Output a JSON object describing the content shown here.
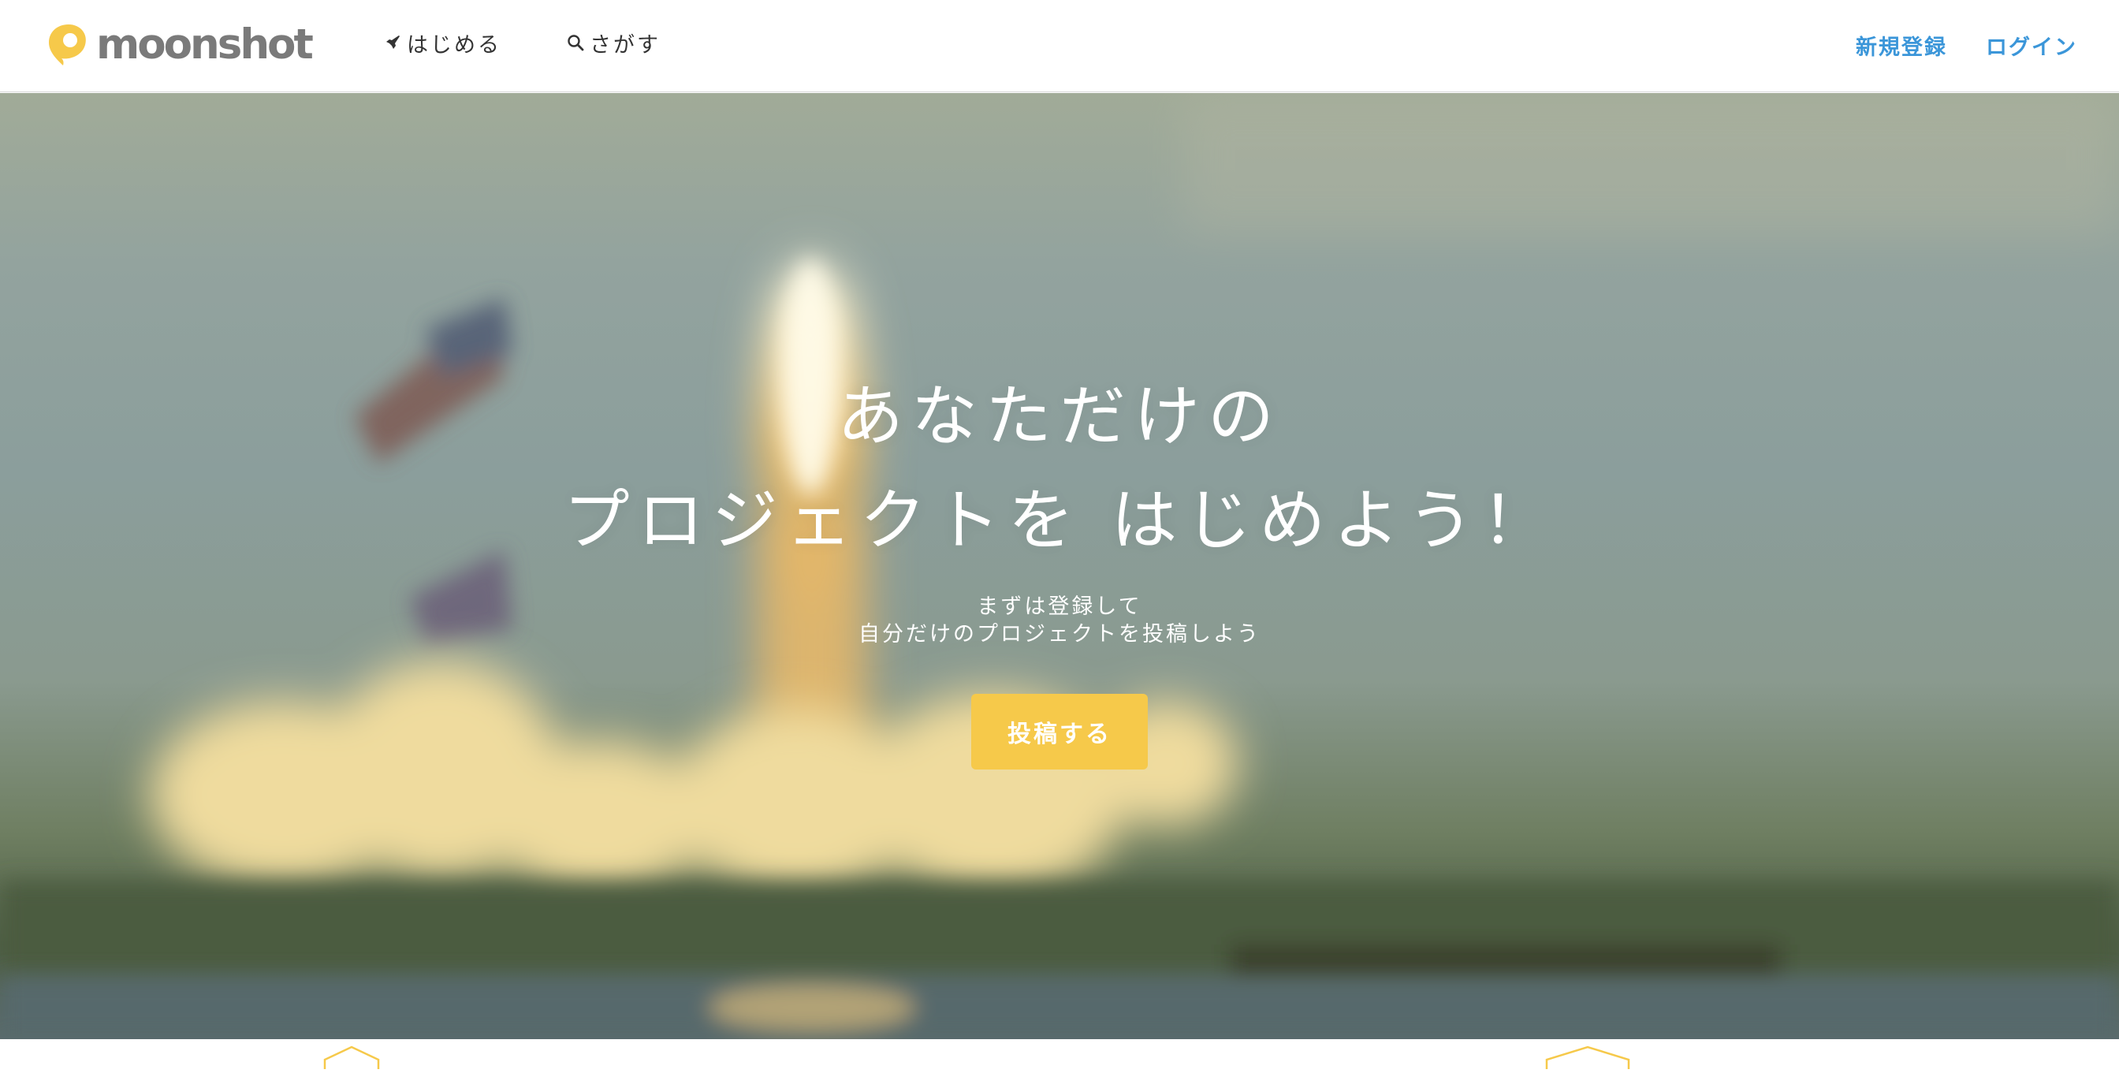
{
  "header": {
    "logo_text": "moonshot",
    "nav": {
      "start_label": "はじめる",
      "search_label": "さがす"
    },
    "auth": {
      "signup_label": "新規登録",
      "login_label": "ログイン"
    }
  },
  "hero": {
    "title_line1": "あなただけの",
    "title_line2": "プロジェクトを はじめよう！",
    "subtitle_line1": "まずは登録して",
    "subtitle_line2": "自分だけのプロジェクトを投稿しよう",
    "cta_label": "投稿する"
  },
  "colors": {
    "brand_yellow": "#f6c94a",
    "link_blue": "#3b96d9",
    "logo_gray": "#7a7a7a"
  },
  "icons": {
    "logo": "moon-pin-icon",
    "start": "rocket-icon",
    "search": "search-icon",
    "feature": "hexagon-icon"
  }
}
